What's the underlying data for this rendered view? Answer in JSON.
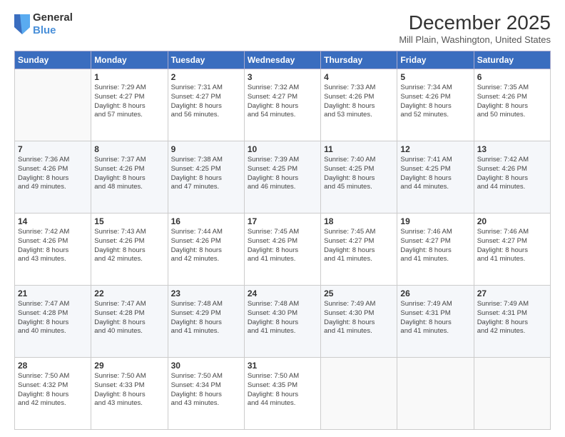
{
  "logo": {
    "general": "General",
    "blue": "Blue"
  },
  "title": "December 2025",
  "subtitle": "Mill Plain, Washington, United States",
  "days_header": [
    "Sunday",
    "Monday",
    "Tuesday",
    "Wednesday",
    "Thursday",
    "Friday",
    "Saturday"
  ],
  "weeks": [
    [
      {
        "num": "",
        "info": ""
      },
      {
        "num": "1",
        "info": "Sunrise: 7:29 AM\nSunset: 4:27 PM\nDaylight: 8 hours\nand 57 minutes."
      },
      {
        "num": "2",
        "info": "Sunrise: 7:31 AM\nSunset: 4:27 PM\nDaylight: 8 hours\nand 56 minutes."
      },
      {
        "num": "3",
        "info": "Sunrise: 7:32 AM\nSunset: 4:27 PM\nDaylight: 8 hours\nand 54 minutes."
      },
      {
        "num": "4",
        "info": "Sunrise: 7:33 AM\nSunset: 4:26 PM\nDaylight: 8 hours\nand 53 minutes."
      },
      {
        "num": "5",
        "info": "Sunrise: 7:34 AM\nSunset: 4:26 PM\nDaylight: 8 hours\nand 52 minutes."
      },
      {
        "num": "6",
        "info": "Sunrise: 7:35 AM\nSunset: 4:26 PM\nDaylight: 8 hours\nand 50 minutes."
      }
    ],
    [
      {
        "num": "7",
        "info": "Sunrise: 7:36 AM\nSunset: 4:26 PM\nDaylight: 8 hours\nand 49 minutes."
      },
      {
        "num": "8",
        "info": "Sunrise: 7:37 AM\nSunset: 4:26 PM\nDaylight: 8 hours\nand 48 minutes."
      },
      {
        "num": "9",
        "info": "Sunrise: 7:38 AM\nSunset: 4:25 PM\nDaylight: 8 hours\nand 47 minutes."
      },
      {
        "num": "10",
        "info": "Sunrise: 7:39 AM\nSunset: 4:25 PM\nDaylight: 8 hours\nand 46 minutes."
      },
      {
        "num": "11",
        "info": "Sunrise: 7:40 AM\nSunset: 4:25 PM\nDaylight: 8 hours\nand 45 minutes."
      },
      {
        "num": "12",
        "info": "Sunrise: 7:41 AM\nSunset: 4:25 PM\nDaylight: 8 hours\nand 44 minutes."
      },
      {
        "num": "13",
        "info": "Sunrise: 7:42 AM\nSunset: 4:26 PM\nDaylight: 8 hours\nand 44 minutes."
      }
    ],
    [
      {
        "num": "14",
        "info": "Sunrise: 7:42 AM\nSunset: 4:26 PM\nDaylight: 8 hours\nand 43 minutes."
      },
      {
        "num": "15",
        "info": "Sunrise: 7:43 AM\nSunset: 4:26 PM\nDaylight: 8 hours\nand 42 minutes."
      },
      {
        "num": "16",
        "info": "Sunrise: 7:44 AM\nSunset: 4:26 PM\nDaylight: 8 hours\nand 42 minutes."
      },
      {
        "num": "17",
        "info": "Sunrise: 7:45 AM\nSunset: 4:26 PM\nDaylight: 8 hours\nand 41 minutes."
      },
      {
        "num": "18",
        "info": "Sunrise: 7:45 AM\nSunset: 4:27 PM\nDaylight: 8 hours\nand 41 minutes."
      },
      {
        "num": "19",
        "info": "Sunrise: 7:46 AM\nSunset: 4:27 PM\nDaylight: 8 hours\nand 41 minutes."
      },
      {
        "num": "20",
        "info": "Sunrise: 7:46 AM\nSunset: 4:27 PM\nDaylight: 8 hours\nand 41 minutes."
      }
    ],
    [
      {
        "num": "21",
        "info": "Sunrise: 7:47 AM\nSunset: 4:28 PM\nDaylight: 8 hours\nand 40 minutes."
      },
      {
        "num": "22",
        "info": "Sunrise: 7:47 AM\nSunset: 4:28 PM\nDaylight: 8 hours\nand 40 minutes."
      },
      {
        "num": "23",
        "info": "Sunrise: 7:48 AM\nSunset: 4:29 PM\nDaylight: 8 hours\nand 41 minutes."
      },
      {
        "num": "24",
        "info": "Sunrise: 7:48 AM\nSunset: 4:30 PM\nDaylight: 8 hours\nand 41 minutes."
      },
      {
        "num": "25",
        "info": "Sunrise: 7:49 AM\nSunset: 4:30 PM\nDaylight: 8 hours\nand 41 minutes."
      },
      {
        "num": "26",
        "info": "Sunrise: 7:49 AM\nSunset: 4:31 PM\nDaylight: 8 hours\nand 41 minutes."
      },
      {
        "num": "27",
        "info": "Sunrise: 7:49 AM\nSunset: 4:31 PM\nDaylight: 8 hours\nand 42 minutes."
      }
    ],
    [
      {
        "num": "28",
        "info": "Sunrise: 7:50 AM\nSunset: 4:32 PM\nDaylight: 8 hours\nand 42 minutes."
      },
      {
        "num": "29",
        "info": "Sunrise: 7:50 AM\nSunset: 4:33 PM\nDaylight: 8 hours\nand 43 minutes."
      },
      {
        "num": "30",
        "info": "Sunrise: 7:50 AM\nSunset: 4:34 PM\nDaylight: 8 hours\nand 43 minutes."
      },
      {
        "num": "31",
        "info": "Sunrise: 7:50 AM\nSunset: 4:35 PM\nDaylight: 8 hours\nand 44 minutes."
      },
      {
        "num": "",
        "info": ""
      },
      {
        "num": "",
        "info": ""
      },
      {
        "num": "",
        "info": ""
      }
    ]
  ]
}
